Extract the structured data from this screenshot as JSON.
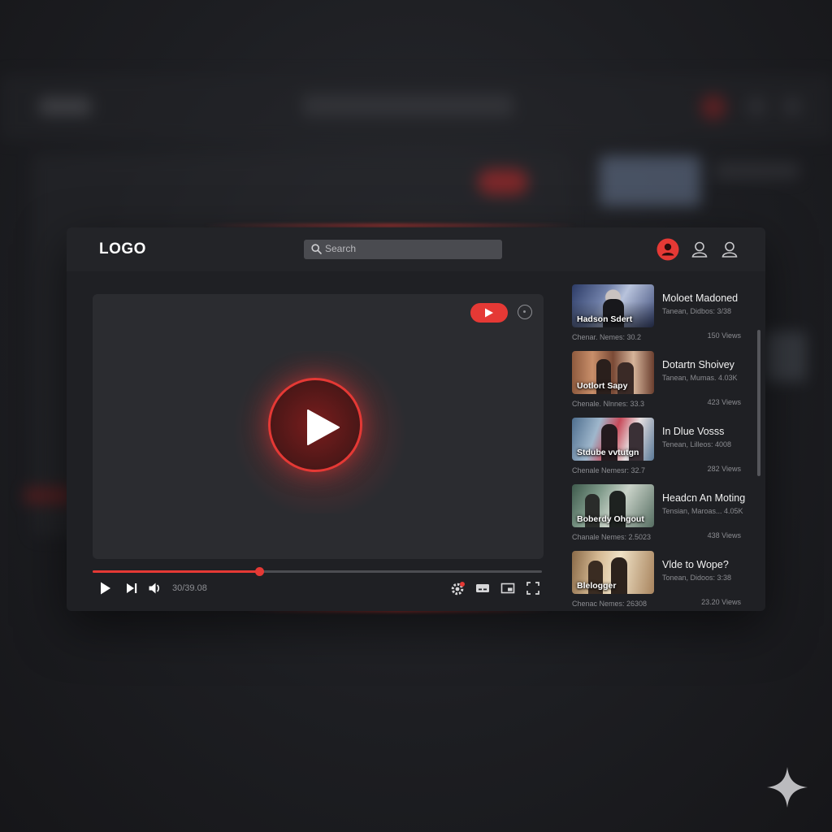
{
  "header": {
    "logo": "LOGO",
    "search_placeholder": "Search",
    "icons": [
      "account-active-icon",
      "user-icon",
      "user-icon"
    ]
  },
  "player": {
    "badge_icon": "youtube-play-icon",
    "info_icon": "info-icon",
    "center_icon": "play-icon",
    "progress": 0.37,
    "time": "30/39.08",
    "controls": [
      "play-icon",
      "skip-next-icon",
      "volume-icon",
      "settings-icon",
      "subtitles-icon",
      "miniplayer-icon",
      "fullscreen-icon"
    ]
  },
  "videos": [
    {
      "thumb_caption": "Hadson Sdert",
      "title": "Moloet Madoned",
      "subtitle": "Tanean, Didbos: 3/38",
      "channel": "Chenar. Nemes: 30.2",
      "views": "150 Views"
    },
    {
      "thumb_caption": "Uotlort Sapy",
      "title": "Dotartn Shoivey",
      "subtitle": "Tanean, Mumas. 4.03K",
      "channel": "Chenale. Nlnnes: 33.3",
      "views": "423 Views"
    },
    {
      "thumb_caption": "Stdube vvtutgn",
      "title": "In Dlue Vosss",
      "subtitle": "Tenean, Lilleos: 4008",
      "channel": "Chenale Nemesr: 32.7",
      "views": "282 Views"
    },
    {
      "thumb_caption": "Boberdy Ohgout",
      "title": "Headcn An Moting",
      "subtitle": "Tensian, Maroas... 4.05K",
      "channel": "Chanale Nemes: 2.5023",
      "views": "438 Views"
    },
    {
      "thumb_caption": "Blelogger",
      "title": "Vlde to Wope?",
      "subtitle": "Tonean, Didoos: 3:38",
      "channel": "Chenac Nemes: 26308",
      "views": "23.20 Views"
    }
  ],
  "colors": {
    "accent": "#e53935",
    "panel": "#1f2024",
    "player": "#2b2c30"
  }
}
